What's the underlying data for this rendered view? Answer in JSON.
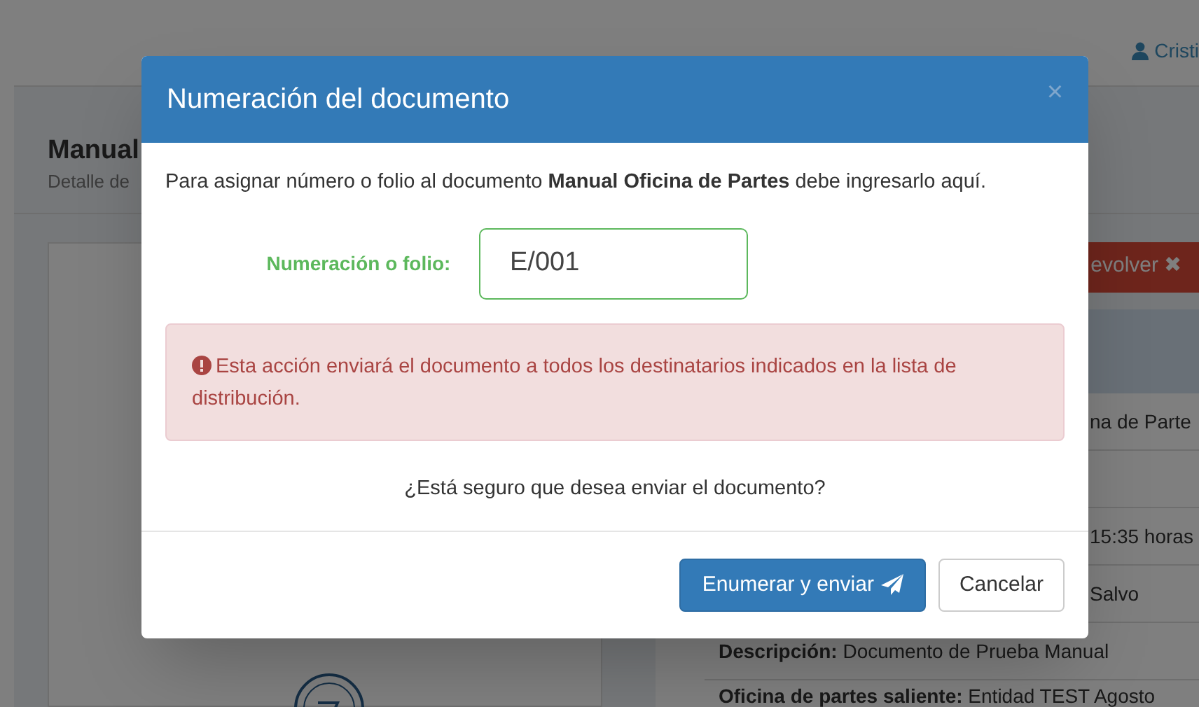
{
  "page": {
    "user_name": "Cristi",
    "title": "Manual",
    "subtitle": "Detalle de",
    "return_button": {
      "label": "evolver",
      "icon": "✖"
    },
    "details": [
      {
        "kind": "covered",
        "value": "na de Parte"
      },
      {
        "kind": "empty"
      },
      {
        "kind": "covered",
        "value": "15:35 horas"
      },
      {
        "kind": "covered",
        "value": "Salvo"
      },
      {
        "kind": "full",
        "label": "Descripción:",
        "value": "Documento de Prueba Manual"
      },
      {
        "kind": "full",
        "label": "Oficina de partes saliente:",
        "value": "Entidad TEST Agosto"
      }
    ]
  },
  "modal": {
    "title": "Numeración del documento",
    "close": "×",
    "message": "Para asignar número o folio al documento **Manual Oficina de Partes** debe ingresarlo aquí.",
    "field": {
      "label": "Numeración o folio:",
      "value": "E/001"
    },
    "alert": "Esta acción enviará el documento a todos los destinatarios indicados en la lista de distribución.",
    "question": "¿Está seguro que desea enviar el documento?",
    "buttons": [
      {
        "label": "Enumerar y enviar",
        "kind": "primary"
      },
      {
        "label": "Cancelar",
        "kind": "default"
      }
    ]
  }
}
